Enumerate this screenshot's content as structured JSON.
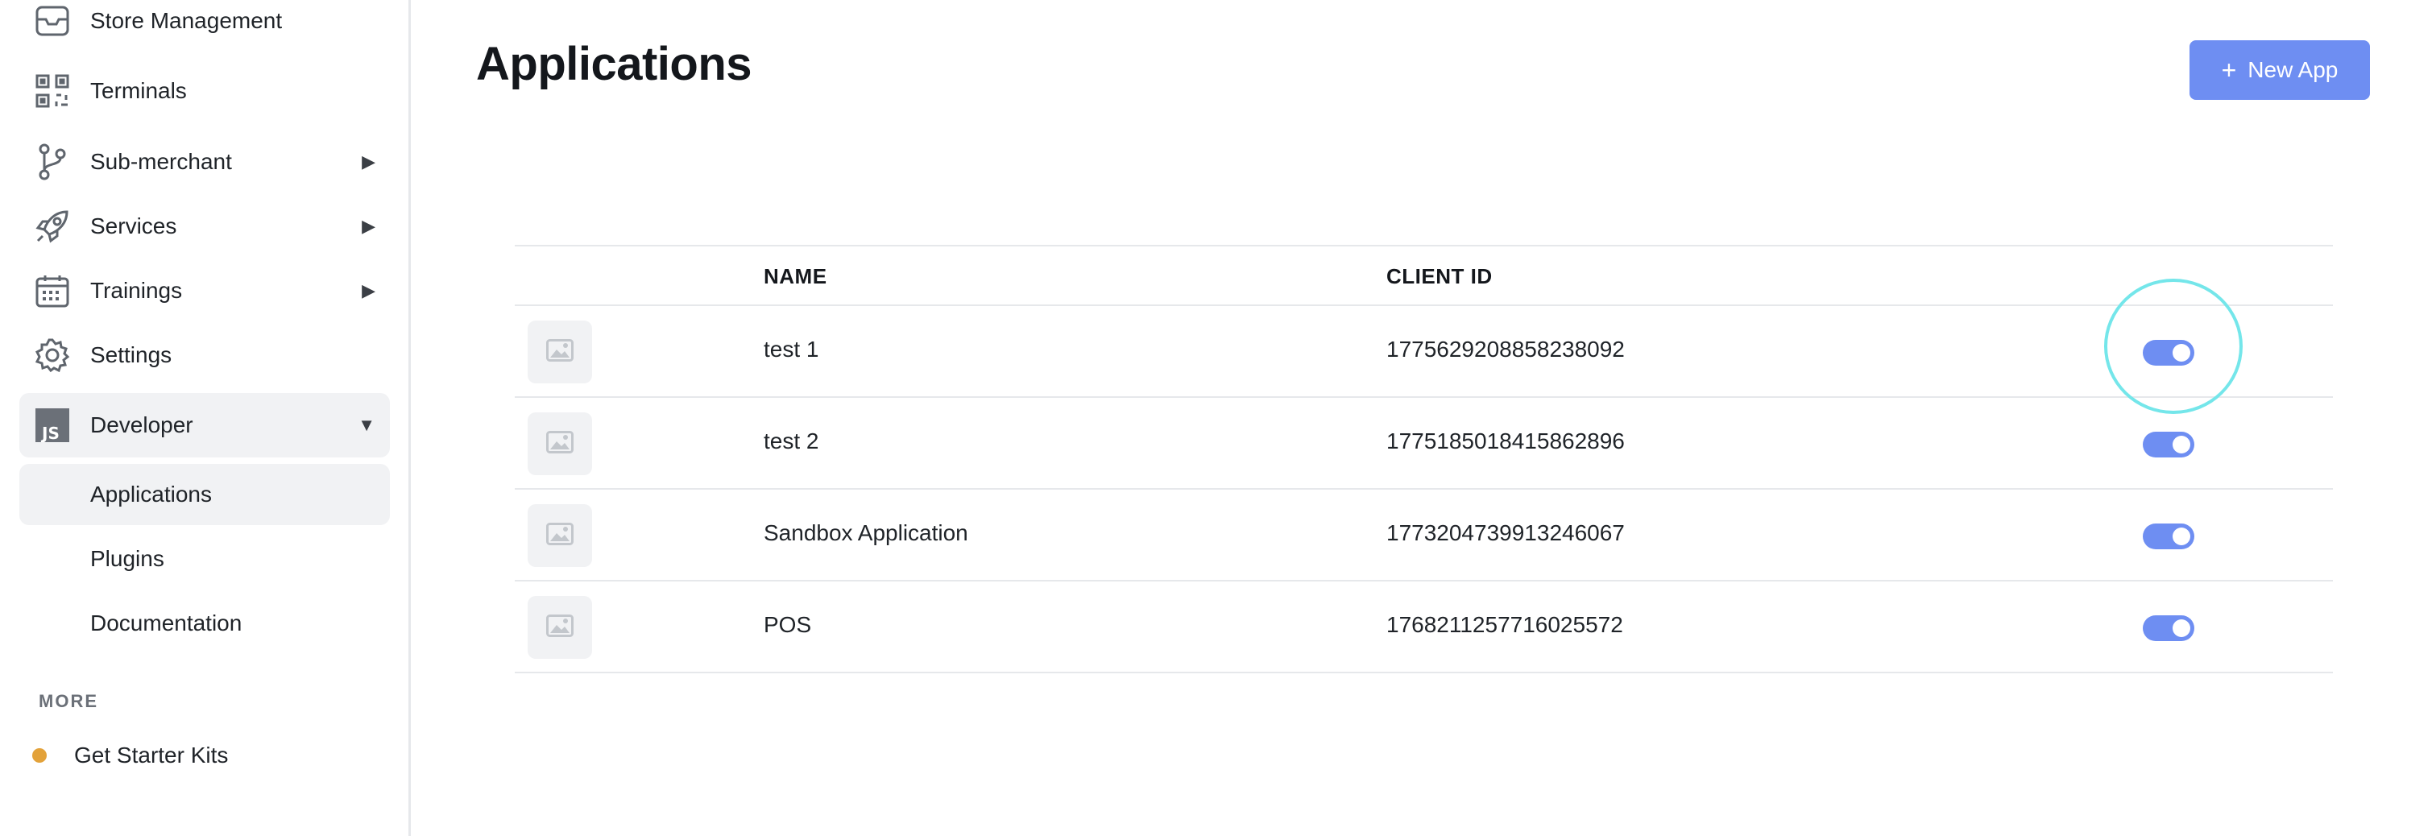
{
  "sidebar": {
    "items": [
      {
        "label": "Store Management",
        "icon": "store-icon",
        "arrow": ""
      },
      {
        "label": "Terminals",
        "icon": "qr-code-icon",
        "arrow": ""
      },
      {
        "label": "Sub-merchant",
        "icon": "branch-icon",
        "arrow": "▶"
      },
      {
        "label": "Services",
        "icon": "rocket-icon",
        "arrow": "▶"
      },
      {
        "label": "Trainings",
        "icon": "calendar-icon",
        "arrow": "▶"
      },
      {
        "label": "Settings",
        "icon": "gear-icon",
        "arrow": ""
      },
      {
        "label": "Developer",
        "icon": "js-icon",
        "arrow": "▼"
      }
    ],
    "developer_sub": [
      {
        "label": "Applications"
      },
      {
        "label": "Plugins"
      },
      {
        "label": "Documentation"
      }
    ],
    "more_label": "MORE",
    "starter_label": "Get Starter Kits",
    "starter_dot_color": "#e3a23a"
  },
  "main": {
    "title": "Applications",
    "new_app_plus": "+",
    "new_app_label": "New App",
    "accent_color": "#6e8ef2",
    "columns": {
      "name": "NAME",
      "client_id": "CLIENT ID"
    },
    "rows": [
      {
        "name": "test 1",
        "client_id": "1775629208858238092",
        "enabled": true
      },
      {
        "name": "test 2",
        "client_id": "1775185018415862896",
        "enabled": true
      },
      {
        "name": "Sandbox Application",
        "client_id": "1773204739913246067",
        "enabled": true
      },
      {
        "name": "POS",
        "client_id": "1768211257716025572",
        "enabled": true
      }
    ]
  }
}
